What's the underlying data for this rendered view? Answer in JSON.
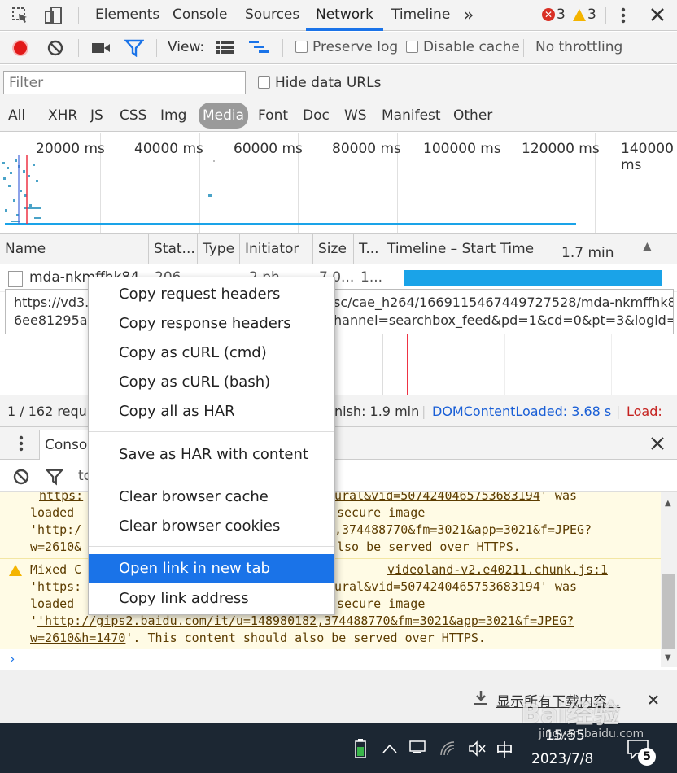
{
  "tabs": [
    "Elements",
    "Console",
    "Sources",
    "Network",
    "Timeline"
  ],
  "more_tabs": "»",
  "errors": {
    "count": "3",
    "color": "#d93025"
  },
  "warnings": {
    "count": "3",
    "color": "#f4b400"
  },
  "toolbar2": {
    "view_label": "View:",
    "preserve_log": "Preserve log",
    "disable_cache": "Disable cache",
    "throttling": "No throttling"
  },
  "filter": {
    "placeholder": "Filter",
    "hide_data_urls": "Hide data URLs",
    "types": [
      "All",
      "XHR",
      "JS",
      "CSS",
      "Img",
      "Media",
      "Font",
      "Doc",
      "WS",
      "Manifest",
      "Other"
    ],
    "selected": "Media"
  },
  "overview": {
    "ticks": [
      "20000 ms",
      "40000 ms",
      "60000 ms",
      "80000 ms",
      "100000 ms",
      "120000 ms",
      "140000 ms"
    ]
  },
  "columns": {
    "name": "Name",
    "status": "Stat...",
    "type": "Type",
    "initiator": "Initiator",
    "size": "Size",
    "time": "T...",
    "timeline": "Timeline – Start Time",
    "duration": "1.7 min",
    "sort_icon": "▲"
  },
  "request_row": {
    "name": "mda-nkmffhk84",
    "status": "206",
    "type": "",
    "initiator": "2.ph",
    "size": "7.0...",
    "time": "1..."
  },
  "tooltip": {
    "line1_left": "https://vd3.",
    "line1_right": "sc/cae_h264/1669115467449727528/mda-nkmffhk84",
    "line2_left": "6ee81295a",
    "line2_right": "hannel=searchbox_feed&pd=1&cd=0&pt=3&logid="
  },
  "status": {
    "requests": "1 / 162 requ",
    "finish": "nish: 1.9 min",
    "dom": "DOMContentLoaded: 3.68 s",
    "load": "Load: ",
    "dom_color": "#1a5fd6",
    "load_color": "#c5221f"
  },
  "drawer": {
    "tab": "Consol"
  },
  "console_toolbar": {
    "filter_text": "to"
  },
  "context_menu": {
    "items": [
      "Copy request headers",
      "Copy response headers",
      "Copy as cURL (cmd)",
      "Copy as cURL (bash)",
      "Copy all as HAR",
      "Save as HAR with content",
      "Clear browser cache",
      "Clear browser cookies",
      "Open link in new tab",
      "Copy link address"
    ],
    "highlighted": "Open link in new tab"
  },
  "console_lines": {
    "l1a": "https:",
    "l1b": "ural&vid=5074240465753683194",
    "l1c": "' was",
    "l2a": "loaded",
    "l2b": "secure image",
    "l3a": "'http:/",
    "l3b": ",374488770&fm=3021&app=3021&f=JPEG?",
    "l4a": "w=2610&",
    "l4b": "lso be served over HTTPS.",
    "l5a": "Mixed C",
    "l5src": "videoland-v2.e40211.chunk.js:1",
    "l6a": "'https:",
    "l6b": "ural&vid=5074240465753683194",
    "l6c": "' was",
    "l7a": "loaded",
    "l7b": "secure image",
    "l8": "'http://gips2.baidu.com/it/u=148980182,374488770&fm=3021&app=3021&f=JPEG?",
    "l9": "w=2610&h=1470",
    "l9b": "'. This content should also be served over HTTPS."
  },
  "download_bar": {
    "show_all": "显示所有下载内容..."
  },
  "taskbar": {
    "ime": "中",
    "time": "15:55",
    "date": "2023/7/8",
    "notifications": "5"
  },
  "watermark": {
    "text": "Bai经验",
    "sub": "jingyan.baidu.com"
  }
}
